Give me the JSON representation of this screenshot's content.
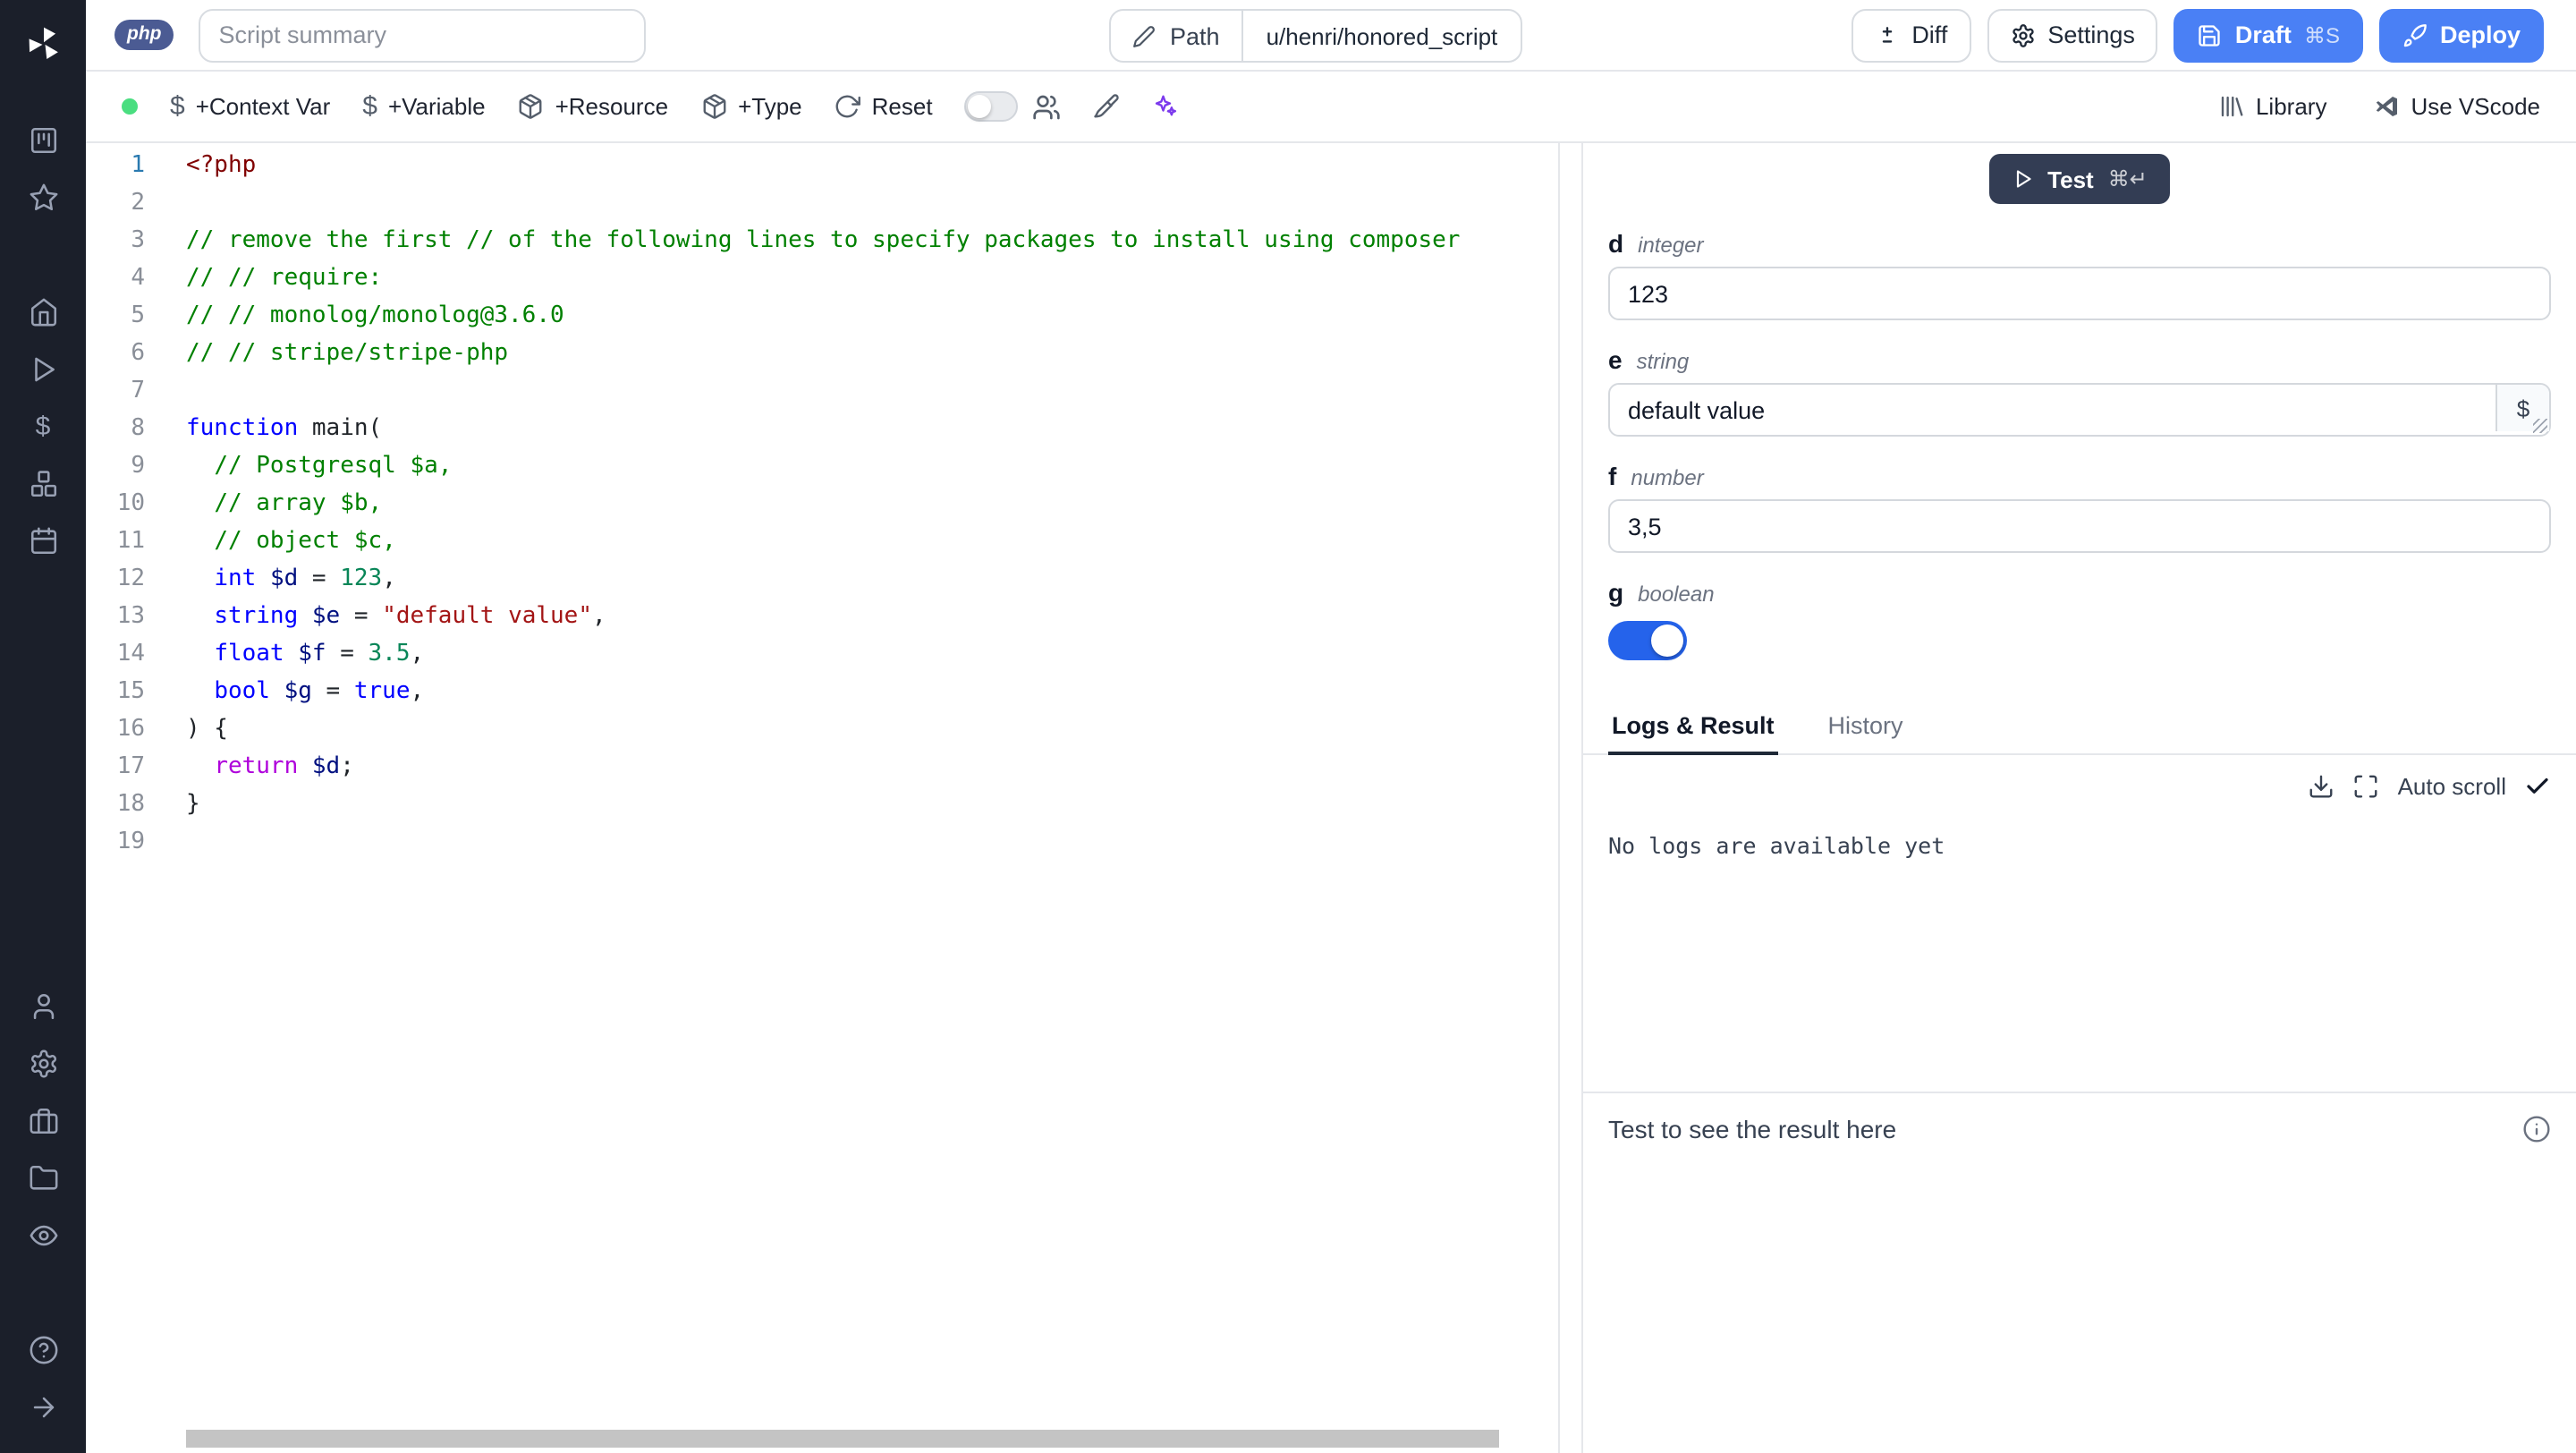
{
  "glyphs": {
    "dollar": "$"
  },
  "colors": {
    "primary_blue": "#4a80f5",
    "toggle_on": "#2563eb",
    "status_dot": "#4ade80",
    "sidebar_bg": "#1b1f2a",
    "test_button": "#333d54"
  },
  "sidebar": {
    "icons": [
      "windmill-logo",
      "kanban-board",
      "star",
      "home",
      "runs-play",
      "variables-dollar",
      "resources-boxes",
      "schedules-calendar",
      "user",
      "settings-gear",
      "workers-toolbox",
      "folders",
      "audit-eye",
      "help-circle",
      "expand-arrow"
    ]
  },
  "header": {
    "lang_badge": "php",
    "summary_placeholder": "Script summary",
    "path_label": "Path",
    "path_value": "u/henri/honored_script",
    "diff_label": "Diff",
    "settings_label": "Settings",
    "draft_label": "Draft",
    "draft_shortcut": "⌘S",
    "deploy_label": "Deploy"
  },
  "toolbar": {
    "add_context_var": "+Context Var",
    "add_variable": "+Variable",
    "add_resource": "+Resource",
    "add_type": "+Type",
    "reset": "Reset",
    "library": "Library",
    "use_vscode": "Use VScode"
  },
  "editor": {
    "language": "php",
    "lines": [
      [
        {
          "c": "tag",
          "t": "<?php"
        }
      ],
      [],
      [
        {
          "c": "com",
          "t": "// remove the first // of the following lines to specify packages to install using composer"
        }
      ],
      [
        {
          "c": "com",
          "t": "// // require:"
        }
      ],
      [
        {
          "c": "com",
          "t": "// // monolog/monolog@3.6.0"
        }
      ],
      [
        {
          "c": "com",
          "t": "// // stripe/stripe-php"
        }
      ],
      [],
      [
        {
          "c": "kw",
          "t": "function"
        },
        {
          "c": "pln",
          "t": " main("
        }
      ],
      [
        {
          "c": "pln",
          "t": "  "
        },
        {
          "c": "com",
          "t": "// Postgresql $a,"
        }
      ],
      [
        {
          "c": "pln",
          "t": "  "
        },
        {
          "c": "com",
          "t": "// array $b,"
        }
      ],
      [
        {
          "c": "pln",
          "t": "  "
        },
        {
          "c": "com",
          "t": "// object $c,"
        }
      ],
      [
        {
          "c": "pln",
          "t": "  "
        },
        {
          "c": "kw",
          "t": "int"
        },
        {
          "c": "pln",
          "t": " "
        },
        {
          "c": "var",
          "t": "$d"
        },
        {
          "c": "pln",
          "t": " = "
        },
        {
          "c": "num",
          "t": "123"
        },
        {
          "c": "pln",
          "t": ","
        }
      ],
      [
        {
          "c": "pln",
          "t": "  "
        },
        {
          "c": "kw",
          "t": "string"
        },
        {
          "c": "pln",
          "t": " "
        },
        {
          "c": "var",
          "t": "$e"
        },
        {
          "c": "pln",
          "t": " = "
        },
        {
          "c": "str",
          "t": "\"default value\""
        },
        {
          "c": "pln",
          "t": ","
        }
      ],
      [
        {
          "c": "pln",
          "t": "  "
        },
        {
          "c": "kw",
          "t": "float"
        },
        {
          "c": "pln",
          "t": " "
        },
        {
          "c": "var",
          "t": "$f"
        },
        {
          "c": "pln",
          "t": " = "
        },
        {
          "c": "num",
          "t": "3.5"
        },
        {
          "c": "pln",
          "t": ","
        }
      ],
      [
        {
          "c": "pln",
          "t": "  "
        },
        {
          "c": "kw",
          "t": "bool"
        },
        {
          "c": "pln",
          "t": " "
        },
        {
          "c": "var",
          "t": "$g"
        },
        {
          "c": "pln",
          "t": " = "
        },
        {
          "c": "kw",
          "t": "true"
        },
        {
          "c": "pln",
          "t": ","
        }
      ],
      [
        {
          "c": "pln",
          "t": ") {"
        }
      ],
      [
        {
          "c": "pln",
          "t": "  "
        },
        {
          "c": "flow",
          "t": "return"
        },
        {
          "c": "pln",
          "t": " "
        },
        {
          "c": "var",
          "t": "$d"
        },
        {
          "c": "pln",
          "t": ";"
        }
      ],
      [
        {
          "c": "pln",
          "t": "}"
        }
      ],
      []
    ]
  },
  "run_panel": {
    "test_label": "Test",
    "test_shortcut": "⌘↵",
    "fields": [
      {
        "name": "d",
        "type": "integer",
        "value": "123",
        "kind": "input"
      },
      {
        "name": "e",
        "type": "string",
        "value": "default value",
        "kind": "textarea"
      },
      {
        "name": "f",
        "type": "number",
        "value": "3,5",
        "kind": "input"
      },
      {
        "name": "g",
        "type": "boolean",
        "value": true,
        "kind": "toggle"
      }
    ],
    "tabs": [
      {
        "label": "Logs & Result",
        "active": true
      },
      {
        "label": "History",
        "active": false
      }
    ],
    "auto_scroll_label": "Auto scroll",
    "logs_empty": "No logs are available yet",
    "result_placeholder": "Test to see the result here"
  }
}
